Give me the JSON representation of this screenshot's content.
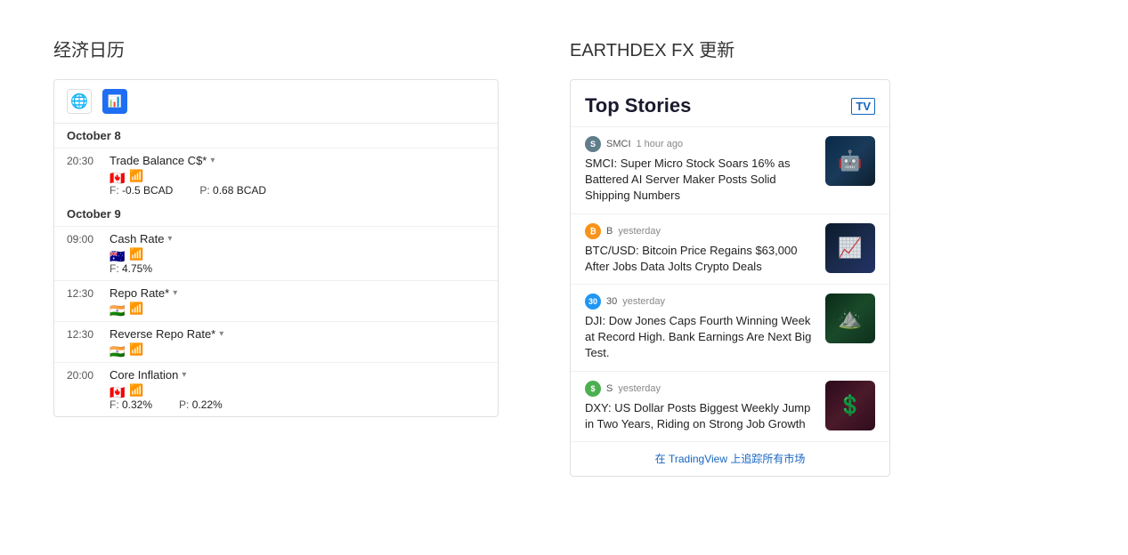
{
  "left": {
    "title": "经济日历",
    "calendar": {
      "dates": [
        {
          "label": "October 8",
          "events": [
            {
              "time": "20:30",
              "name": "Trade Balance C$*",
              "flag": "🇨🇦",
              "values": [
                {
                  "label": "F:",
                  "val": "-0.5 BCAD"
                },
                {
                  "label": "P:",
                  "val": "0.68 BCAD"
                }
              ]
            }
          ]
        },
        {
          "label": "October 9",
          "events": [
            {
              "time": "09:00",
              "name": "Cash Rate",
              "flag": "🇦🇺",
              "values": [
                {
                  "label": "F:",
                  "val": "4.75%"
                }
              ]
            },
            {
              "time": "12:30",
              "name": "Repo Rate*",
              "flag": "🇮🇳",
              "values": []
            },
            {
              "time": "12:30",
              "name": "Reverse Repo Rate*",
              "flag": "🇮🇳",
              "values": []
            },
            {
              "time": "20:00",
              "name": "Core Inflation",
              "flag": "🇨🇦",
              "values": [
                {
                  "label": "F:",
                  "val": "0.32%"
                },
                {
                  "label": "P:",
                  "val": "0.22%"
                }
              ]
            }
          ]
        }
      ]
    }
  },
  "right": {
    "title": "EARTHDEX FX 更新",
    "news": {
      "widget_title": "Top Stories",
      "tv_label": "TV",
      "items": [
        {
          "source": "SMCI",
          "time": "1 hour ago",
          "text": "SMCI: Super Micro Stock Soars 16% as Battered AI Server Maker Posts Solid Shipping Numbers",
          "avatar_color": "#607d8b",
          "avatar_letter": "S",
          "thumb_type": "smci"
        },
        {
          "source": "B",
          "time": "yesterday",
          "text": "BTC/USD: Bitcoin Price Regains $63,000 After Jobs Data Jolts Crypto Deals",
          "avatar_color": "#f7931a",
          "avatar_letter": "B",
          "thumb_type": "btc"
        },
        {
          "source": "30",
          "time": "yesterday",
          "text": "DJI: Dow Jones Caps Fourth Winning Week at Record High. Bank Earnings Are Next Big Test.",
          "avatar_color": "#2196f3",
          "avatar_letter": "3",
          "thumb_type": "dji"
        },
        {
          "source": "S",
          "time": "yesterday",
          "text": "DXY: US Dollar Posts Biggest Weekly Jump in Two Years, Riding on Strong Job Growth",
          "avatar_color": "#4caf50",
          "avatar_letter": "S",
          "thumb_type": "dxy"
        }
      ],
      "footer_link": "在 TradingView 上追踪所有市场"
    }
  }
}
